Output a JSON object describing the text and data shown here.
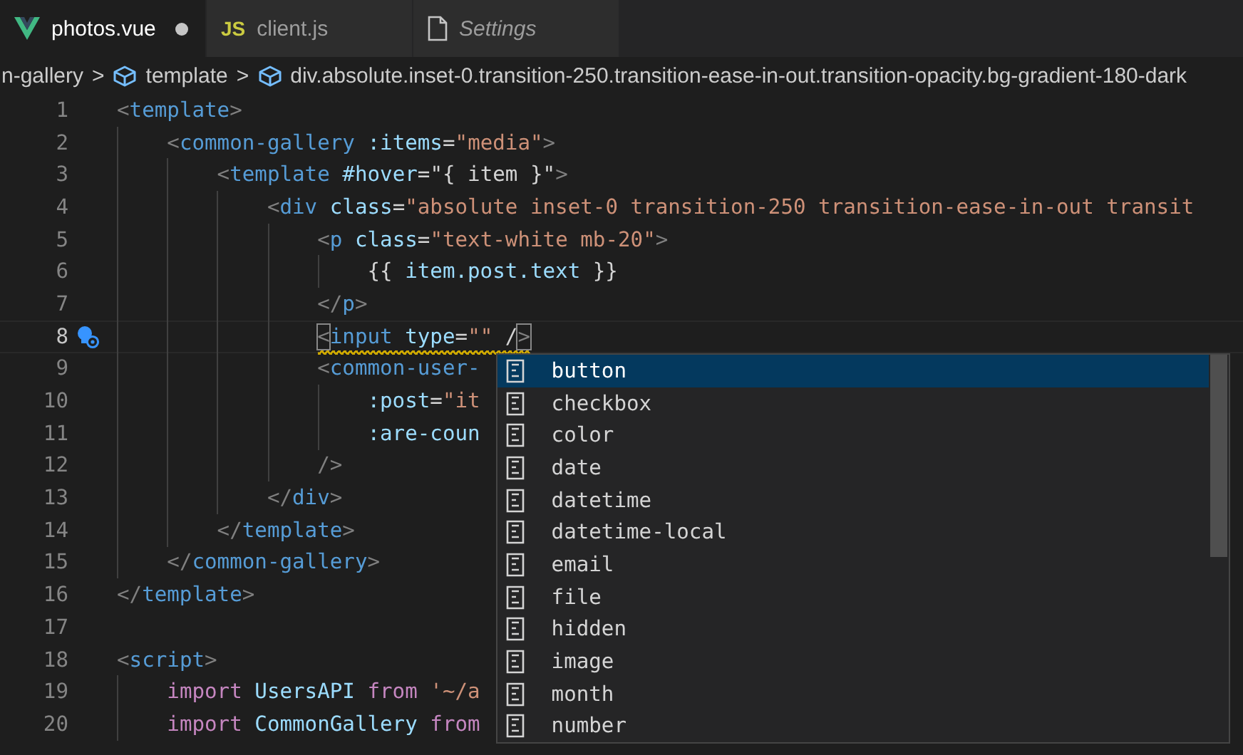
{
  "tabs": [
    {
      "label": "photos.vue",
      "kind": "vue",
      "selected": true,
      "modified": true,
      "preview": false
    },
    {
      "label": "client.js",
      "kind": "js",
      "icon_text": "JS",
      "selected": false,
      "modified": false,
      "preview": false
    },
    {
      "label": "Settings",
      "kind": "file",
      "selected": false,
      "modified": false,
      "preview": true
    }
  ],
  "breadcrumbs": [
    {
      "label": "n-gallery",
      "icon": false
    },
    {
      "label": "template",
      "icon": true
    },
    {
      "label": "div.absolute.inset-0.transition-250.transition-ease-in-out.transition-opacity.bg-gradient-180-dark",
      "icon": true
    }
  ],
  "breadcrumb_separator": ">",
  "lines": [
    {
      "number": "1",
      "current": false,
      "tokens": [
        {
          "kind": "punct",
          "text": "<"
        },
        {
          "kind": "tag",
          "text": "template"
        },
        {
          "kind": "punct",
          "text": ">"
        }
      ]
    },
    {
      "number": "2",
      "current": false,
      "tokens": [
        {
          "kind": "punct",
          "text": "    <"
        },
        {
          "kind": "tag",
          "text": "common-gallery"
        },
        {
          "kind": "attr",
          "text": " :items"
        },
        {
          "kind": "plain",
          "text": "="
        },
        {
          "kind": "string",
          "text": "\"media\""
        },
        {
          "kind": "punct",
          "text": ">"
        }
      ]
    },
    {
      "number": "3",
      "current": false,
      "tokens": [
        {
          "kind": "punct",
          "text": "        <"
        },
        {
          "kind": "tag",
          "text": "template"
        },
        {
          "kind": "attr",
          "text": " #hover"
        },
        {
          "kind": "plain",
          "text": "="
        },
        {
          "kind": "plain",
          "text": "\"{ item }\""
        },
        {
          "kind": "punct",
          "text": ">"
        }
      ]
    },
    {
      "number": "4",
      "current": false,
      "tokens": [
        {
          "kind": "punct",
          "text": "            <"
        },
        {
          "kind": "tag",
          "text": "div"
        },
        {
          "kind": "attr",
          "text": " class"
        },
        {
          "kind": "plain",
          "text": "="
        },
        {
          "kind": "string",
          "text": "\"absolute inset-0 transition-250 transition-ease-in-out transit"
        }
      ]
    },
    {
      "number": "5",
      "current": false,
      "tokens": [
        {
          "kind": "punct",
          "text": "                <"
        },
        {
          "kind": "tag",
          "text": "p"
        },
        {
          "kind": "attr",
          "text": " class"
        },
        {
          "kind": "plain",
          "text": "="
        },
        {
          "kind": "string",
          "text": "\"text-white mb-20\""
        },
        {
          "kind": "punct",
          "text": ">"
        }
      ]
    },
    {
      "number": "6",
      "current": false,
      "tokens": [
        {
          "kind": "plain",
          "text": "                    {{ "
        },
        {
          "kind": "var",
          "text": "item.post.text"
        },
        {
          "kind": "plain",
          "text": " }}"
        }
      ]
    },
    {
      "number": "7",
      "current": false,
      "tokens": [
        {
          "kind": "punct",
          "text": "                </"
        },
        {
          "kind": "tag",
          "text": "p"
        },
        {
          "kind": "punct",
          "text": ">"
        }
      ]
    },
    {
      "number": "8",
      "current": true,
      "squiggle": true,
      "tokens": [
        {
          "kind": "match",
          "text": "                <"
        },
        {
          "kind": "tag",
          "text": "input"
        },
        {
          "kind": "attr",
          "text": " type"
        },
        {
          "kind": "plain",
          "text": "="
        },
        {
          "kind": "string",
          "text": "\"\""
        },
        {
          "kind": "plain",
          "text": " /"
        },
        {
          "kind": "match",
          "text": ">"
        }
      ]
    },
    {
      "number": "9",
      "current": false,
      "tokens": [
        {
          "kind": "punct",
          "text": "                <"
        },
        {
          "kind": "tag",
          "text": "common-user-"
        }
      ]
    },
    {
      "number": "10",
      "current": false,
      "tokens": [
        {
          "kind": "attr",
          "text": "                    :post"
        },
        {
          "kind": "plain",
          "text": "="
        },
        {
          "kind": "string",
          "text": "\"it"
        }
      ]
    },
    {
      "number": "11",
      "current": false,
      "tokens": [
        {
          "kind": "attr",
          "text": "                    :are-coun"
        }
      ]
    },
    {
      "number": "12",
      "current": false,
      "tokens": [
        {
          "kind": "punct",
          "text": "                />"
        }
      ]
    },
    {
      "number": "13",
      "current": false,
      "tokens": [
        {
          "kind": "punct",
          "text": "            </"
        },
        {
          "kind": "tag",
          "text": "div"
        },
        {
          "kind": "punct",
          "text": ">"
        }
      ]
    },
    {
      "number": "14",
      "current": false,
      "tokens": [
        {
          "kind": "punct",
          "text": "        </"
        },
        {
          "kind": "tag",
          "text": "template"
        },
        {
          "kind": "punct",
          "text": ">"
        }
      ]
    },
    {
      "number": "15",
      "current": false,
      "tokens": [
        {
          "kind": "punct",
          "text": "    </"
        },
        {
          "kind": "tag",
          "text": "common-gallery"
        },
        {
          "kind": "punct",
          "text": ">"
        }
      ]
    },
    {
      "number": "16",
      "current": false,
      "tokens": [
        {
          "kind": "punct",
          "text": "</"
        },
        {
          "kind": "tag",
          "text": "template"
        },
        {
          "kind": "punct",
          "text": ">"
        }
      ]
    },
    {
      "number": "17",
      "current": false
    },
    {
      "number": "18",
      "current": false,
      "tokens": [
        {
          "kind": "punct",
          "text": "<"
        },
        {
          "kind": "tag",
          "text": "script"
        },
        {
          "kind": "punct",
          "text": ">"
        }
      ]
    },
    {
      "number": "19",
      "current": false,
      "tokens": [
        {
          "kind": "keyword",
          "text": "    import"
        },
        {
          "kind": "var",
          "text": " UsersAPI"
        },
        {
          "kind": "keyword",
          "text": " from"
        },
        {
          "kind": "string",
          "text": " '~/a"
        }
      ]
    },
    {
      "number": "20",
      "current": false,
      "tokens": [
        {
          "kind": "keyword",
          "text": "    import"
        },
        {
          "kind": "var",
          "text": " CommonGallery"
        },
        {
          "kind": "keyword",
          "text": " from"
        }
      ]
    }
  ],
  "suggestions": [
    {
      "label": "button",
      "selected": true
    },
    {
      "label": "checkbox",
      "selected": false
    },
    {
      "label": "color",
      "selected": false
    },
    {
      "label": "date",
      "selected": false
    },
    {
      "label": "datetime",
      "selected": false
    },
    {
      "label": "datetime-local",
      "selected": false
    },
    {
      "label": "email",
      "selected": false
    },
    {
      "label": "file",
      "selected": false
    },
    {
      "label": "hidden",
      "selected": false
    },
    {
      "label": "image",
      "selected": false
    },
    {
      "label": "month",
      "selected": false
    },
    {
      "label": "number",
      "selected": false
    }
  ]
}
